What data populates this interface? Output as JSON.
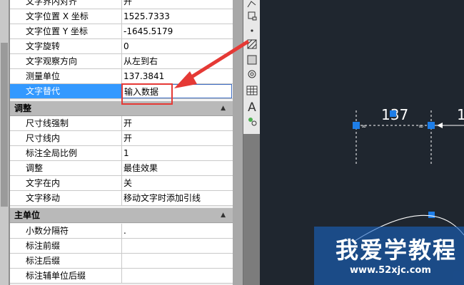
{
  "properties": {
    "top_rows": [
      {
        "label": "文字界内对齐",
        "value": "开"
      },
      {
        "label": "文字位置 X 坐标",
        "value": "1525.7333"
      },
      {
        "label": "文字位置 Y 坐标",
        "value": "-1645.5179"
      },
      {
        "label": "文字旋转",
        "value": "0"
      },
      {
        "label": "文字观察方向",
        "value": "从左到右"
      },
      {
        "label": "测量单位",
        "value": "137.3841"
      },
      {
        "label": "文字替代",
        "value": "输入数据",
        "selected": true
      }
    ],
    "sections": [
      {
        "title": "调整",
        "rows": [
          {
            "label": "尺寸线强制",
            "value": "开"
          },
          {
            "label": "尺寸线内",
            "value": "开"
          },
          {
            "label": "标注全局比例",
            "value": "1"
          },
          {
            "label": "调整",
            "value": "最佳效果"
          },
          {
            "label": "文字在内",
            "value": "关"
          },
          {
            "label": "文字移动",
            "value": "移动文字时添加引线"
          }
        ]
      },
      {
        "title": "主单位",
        "rows": [
          {
            "label": "小数分隔符",
            "value": "."
          },
          {
            "label": "标注前缀",
            "value": ""
          },
          {
            "label": "标注后缀",
            "value": ""
          },
          {
            "label": "标注辅单位后缀",
            "value": ""
          }
        ]
      }
    ]
  },
  "canvas": {
    "dimension_text_left": "137",
    "dimension_text_right": "1"
  },
  "watermark": {
    "title": "我爱学教程",
    "url": "www.52xjc.com"
  },
  "toolbar": {
    "icons": [
      "polyline-icon",
      "region-icon",
      "point-icon",
      "hatch-icon",
      "gradient-icon",
      "revcloud-icon",
      "table-icon",
      "text-icon",
      "attribute-icon"
    ],
    "text_icon_label": "A"
  },
  "colors": {
    "selection": "#3399ff",
    "highlight_box": "#e53935",
    "arrow": "#e53935",
    "grip": "#1e7ee8",
    "canvas_bg": "#1f262f"
  }
}
